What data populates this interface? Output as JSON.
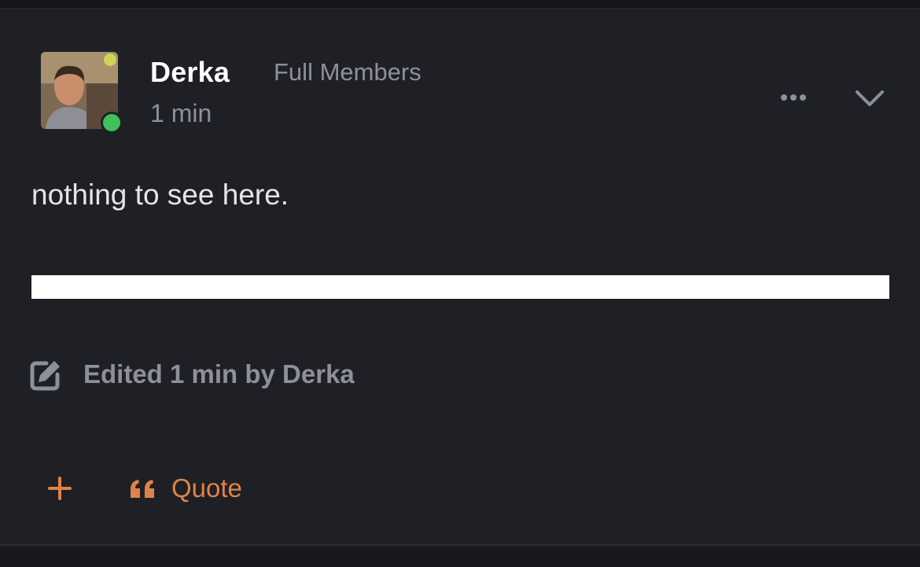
{
  "post": {
    "author": {
      "name": "Derka",
      "group": "Full Members",
      "online": true,
      "avatar_icon": "user-avatar-photo"
    },
    "time": "1 min",
    "body": "nothing to see here.",
    "edited_note": "Edited 1 min by Derka",
    "actions": {
      "quote_label": "Quote",
      "more_icon": "ellipsis-icon",
      "chevron_icon": "chevron-down-icon",
      "plus_icon": "plus-icon",
      "quote_icon": "quote-icon",
      "edit_icon": "edit-icon"
    }
  },
  "colors": {
    "background": "#1f2025",
    "text_primary": "#ffffff",
    "text_secondary": "#8d909a",
    "accent": "#e0834a",
    "online": "#3ec05a"
  }
}
